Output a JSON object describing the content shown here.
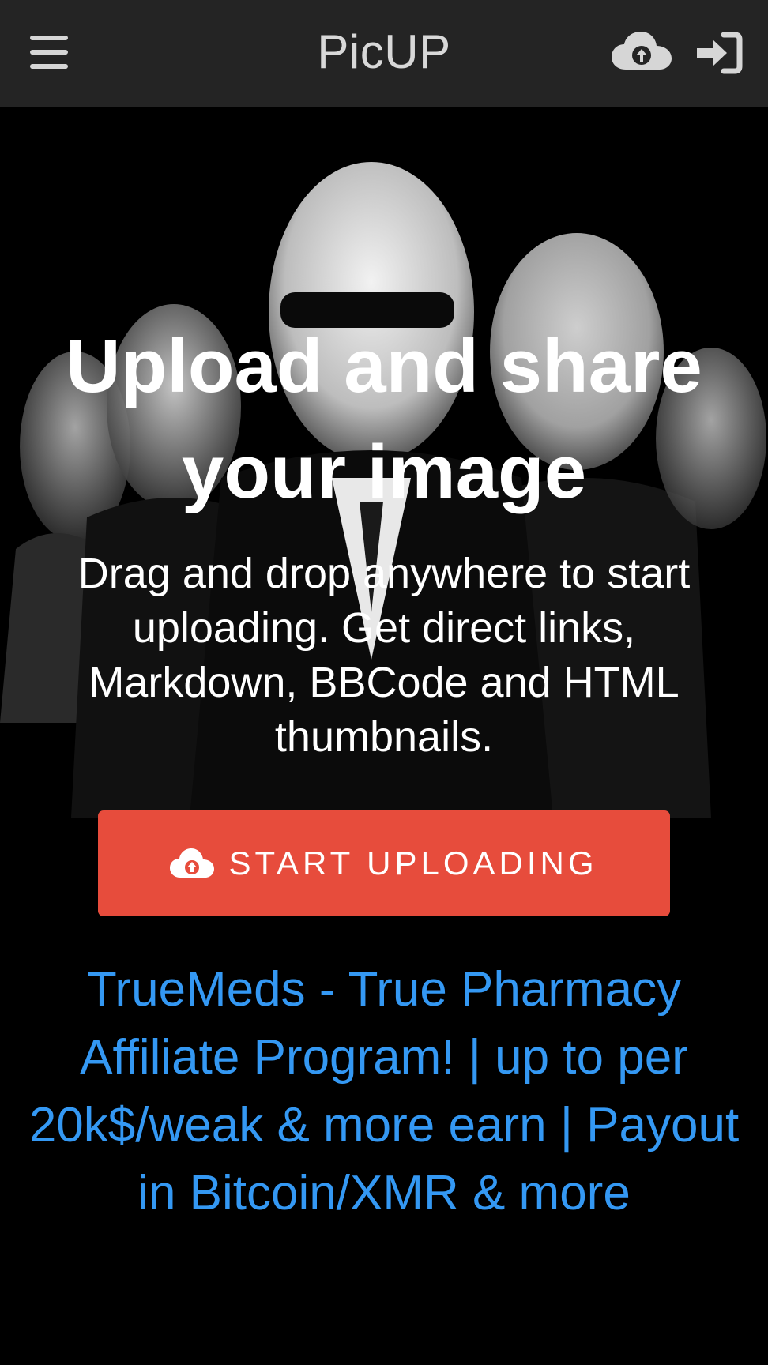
{
  "header": {
    "brand": "PicUP",
    "menu_icon": "hamburger-menu-icon",
    "upload_icon": "cloud-upload-icon",
    "login_icon": "sign-in-icon",
    "background": "#242424"
  },
  "hero": {
    "title": "Upload and share your image",
    "subtitle": "Drag and drop anywhere to start uploading. Get direct links, Markdown, BBCode and HTML thumbnails.",
    "background_image": "black-and-white group portrait of men in suits",
    "start_button": {
      "label": "START UPLOADING",
      "icon": "cloud-upload-icon",
      "color": "#e74c3c"
    },
    "ad_link": {
      "text": "TrueMeds - True Pharmacy Affiliate Program! | up to per 20k$/weak & more earn | Payout in Bitcoin/XMR & more",
      "color": "#3498f3"
    }
  }
}
